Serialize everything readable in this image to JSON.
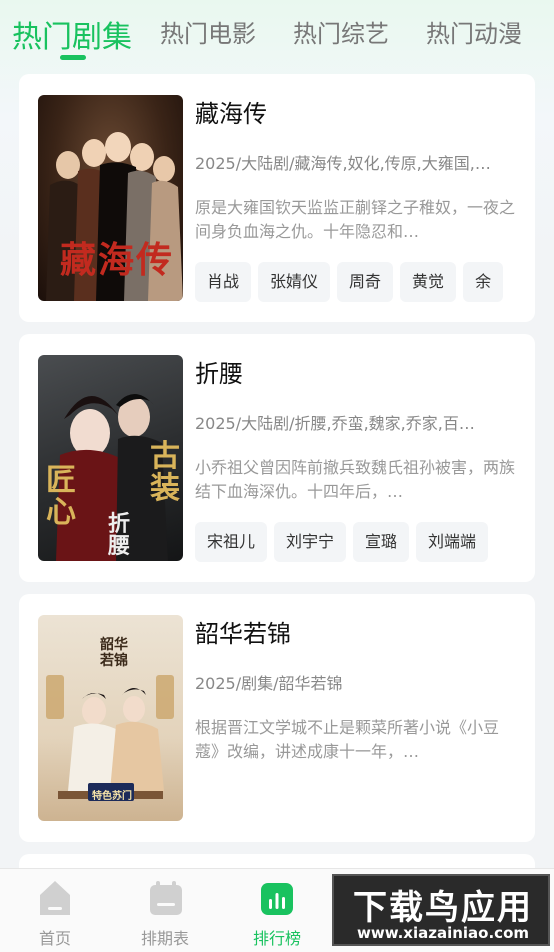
{
  "tabs": [
    {
      "label": "热门剧集",
      "active": true
    },
    {
      "label": "热门电影",
      "active": false
    },
    {
      "label": "热门综艺",
      "active": false
    },
    {
      "label": "热门动漫",
      "active": false
    }
  ],
  "colors": {
    "accent": "#19c25f"
  },
  "cards": [
    {
      "title": "藏海传",
      "meta": "2025/大陆剧/藏海传,奴化,传原,大雍国,…",
      "desc": "原是大雍国钦天监监正蒯铎之子稚奴，一夜之间身负血海之仇。十年隐忍和…",
      "cast": [
        "肖战",
        "张婧仪",
        "周奇",
        "黄觉",
        "余"
      ],
      "poster_text": "藏海传"
    },
    {
      "title": "折腰",
      "meta": "2025/大陆剧/折腰,乔蛮,魏家,乔家,百…",
      "desc": "小乔祖父曾因阵前撤兵致魏氏祖孙被害，两族结下血海深仇。十四年后，…",
      "cast": [
        "宋祖儿",
        "刘宇宁",
        "宣璐",
        "刘端端"
      ],
      "poster_text_left": "匠心",
      "poster_text_right": "古装",
      "poster_text_center": "折腰"
    },
    {
      "title": "韶华若锦",
      "meta": "2025/剧集/韶华若锦",
      "desc": "根据晋江文学城不止是颗菜所著小说《小豆蔻》改编，讲述成康十一年，…",
      "cast": [],
      "poster_text": "韶华若锦",
      "poster_badge": "特色苏门"
    }
  ],
  "bottom_nav": [
    {
      "label": "首页",
      "icon": "home-icon",
      "active": false
    },
    {
      "label": "排期表",
      "icon": "calendar-icon",
      "active": false
    },
    {
      "label": "排行榜",
      "icon": "chart-icon",
      "active": true
    }
  ],
  "watermark": {
    "line1": "下载鸟应用",
    "line2": "www.xiazainiao.com"
  }
}
